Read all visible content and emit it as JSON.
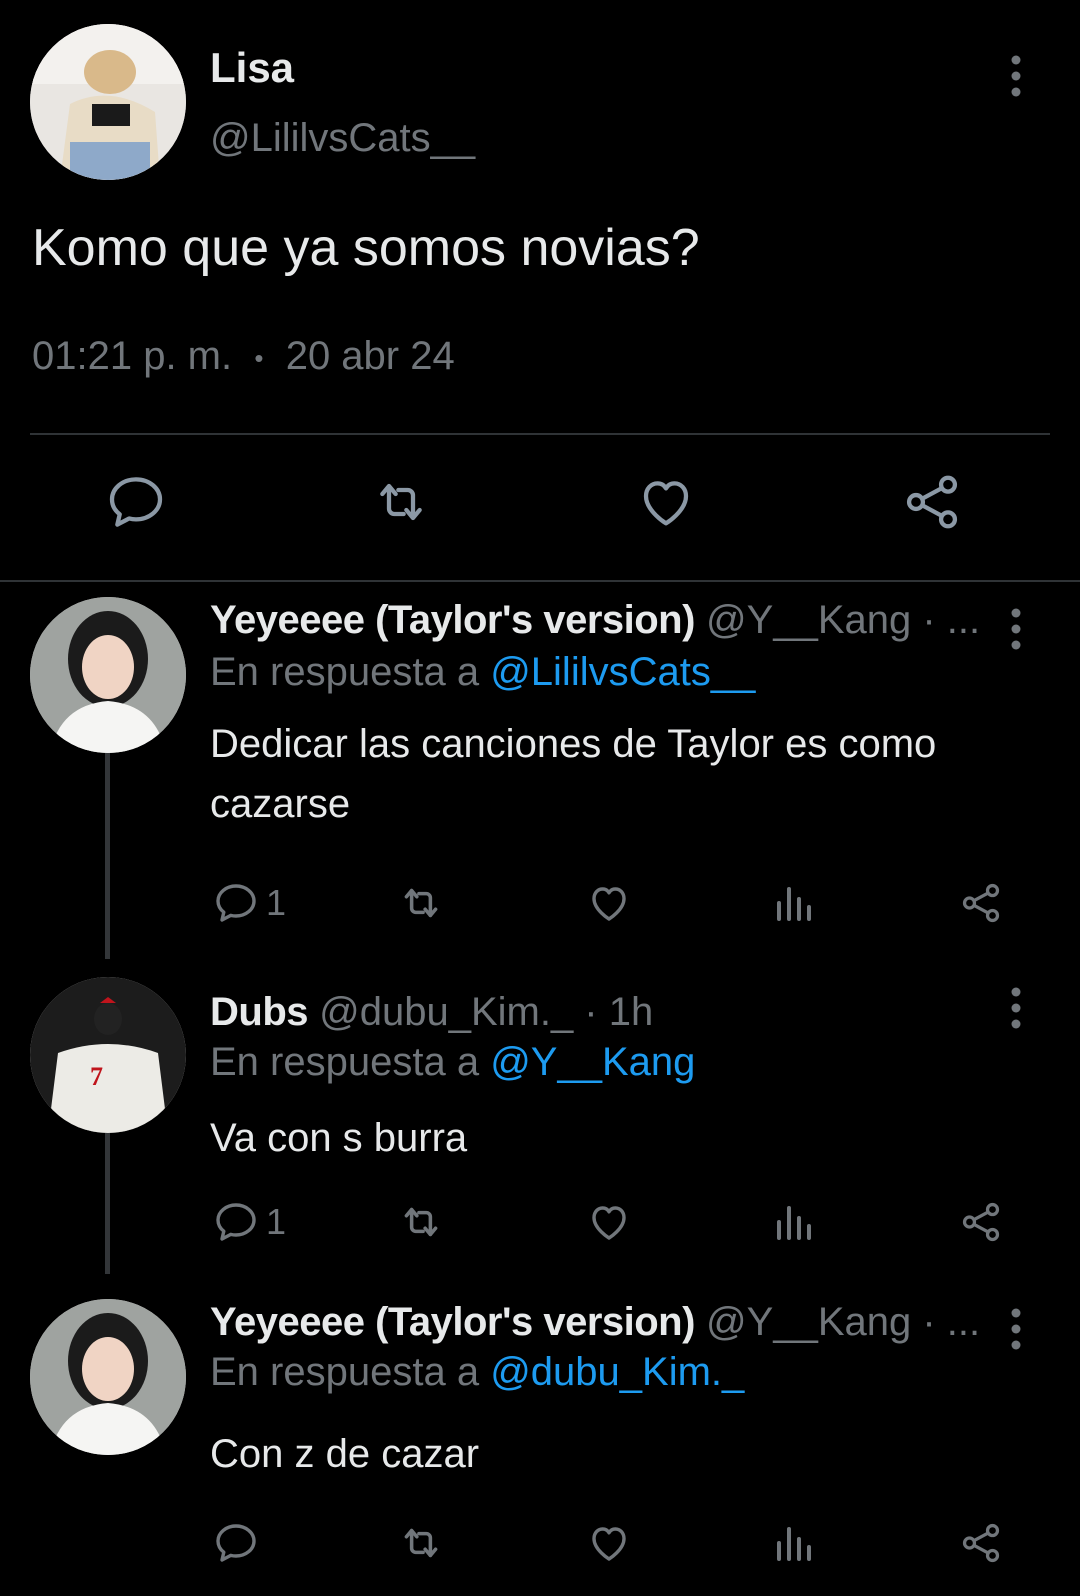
{
  "main_tweet": {
    "author_name": "Lisa",
    "author_handle": "@LililvsCats__",
    "text": "Komo que ya somos novias?",
    "time": "01:21 p. m.",
    "separator": "•",
    "date": "20 abr 24"
  },
  "replies": [
    {
      "name": "Yeyeeee (Taylor's version)",
      "meta": " @Y__Kang · ...",
      "reply_prefix": "En respuesta a ",
      "reply_to": "@LililvsCats__",
      "text": "Dedicar las canciones de Taylor es como cazarse",
      "reply_count": "1"
    },
    {
      "name": "Dubs",
      "meta": " @dubu_Kim._ · 1h",
      "reply_prefix": "En respuesta a ",
      "reply_to": "@Y__Kang",
      "text": "Va con s burra",
      "reply_count": "1"
    },
    {
      "name": "Yeyeeee (Taylor's version)",
      "meta": " @Y__Kang · ...",
      "reply_prefix": "En respuesta a ",
      "reply_to": "@dubu_Kim._",
      "text": "Con z de cazar",
      "reply_count": ""
    }
  ],
  "colors": {
    "background": "#000000",
    "text": "#e7e9ea",
    "muted": "#71767b",
    "link": "#1d9bf0",
    "divider": "#2f3336"
  },
  "icons": [
    "more-icon",
    "reply-icon",
    "retweet-icon",
    "like-icon",
    "share-icon",
    "views-icon"
  ]
}
